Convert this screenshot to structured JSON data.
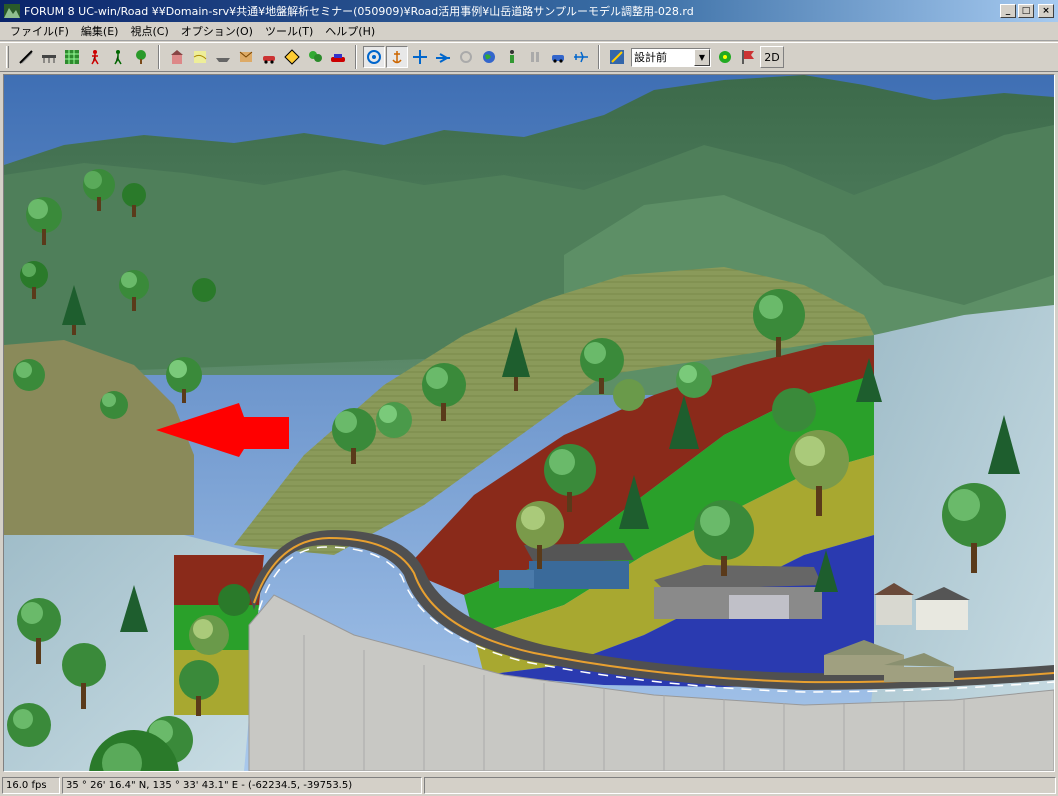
{
  "window": {
    "title": "FORUM 8    UC-win/Road    ¥¥Domain-srv¥共通¥地盤解析セミナー(050909)¥Road活用事例¥山岳道路サンプルーモデル調整用-028.rd",
    "minimize_label": "_",
    "maximize_label": "□",
    "close_label": "×"
  },
  "menu": {
    "items": [
      {
        "label": "ファイル(F)"
      },
      {
        "label": "編集(E)"
      },
      {
        "label": "視点(C)"
      },
      {
        "label": "オプション(O)"
      },
      {
        "label": "ツール(T)"
      },
      {
        "label": "ヘルプ(H)"
      }
    ]
  },
  "toolbar": {
    "group1_icons": [
      "road-icon",
      "bridge-icon",
      "terrain-icon",
      "pedestrian-icon",
      "walk-icon",
      "tree-icon"
    ],
    "group2_icons": [
      "building-icon",
      "map-icon",
      "boat-icon",
      "object-icon",
      "vehicle-icon",
      "sign-icon",
      "landscape-icon",
      "car-icon"
    ],
    "group3_icons": [
      "rotate-view-icon",
      "anchor-icon",
      "move-icon",
      "fly-icon",
      "flower-icon",
      "globe-icon",
      "person-icon",
      "pause-icon",
      "drive-icon",
      "airplane-icon"
    ],
    "scenario_combo_value": "設計前",
    "combo_arrow": "▼",
    "btn_2d_label": "2D"
  },
  "colors": {
    "titlebar_start": "#0a246a",
    "titlebar_end": "#a6caf0",
    "chrome": "#d4d0c8",
    "red_arrow": "#ff0000"
  },
  "statusbar": {
    "fps": "16.0 fps",
    "coordinates": "35 °   26' 16.4\" N, 135 °   33' 43.1\" E  -  (-62234.5, -39753.5)"
  }
}
